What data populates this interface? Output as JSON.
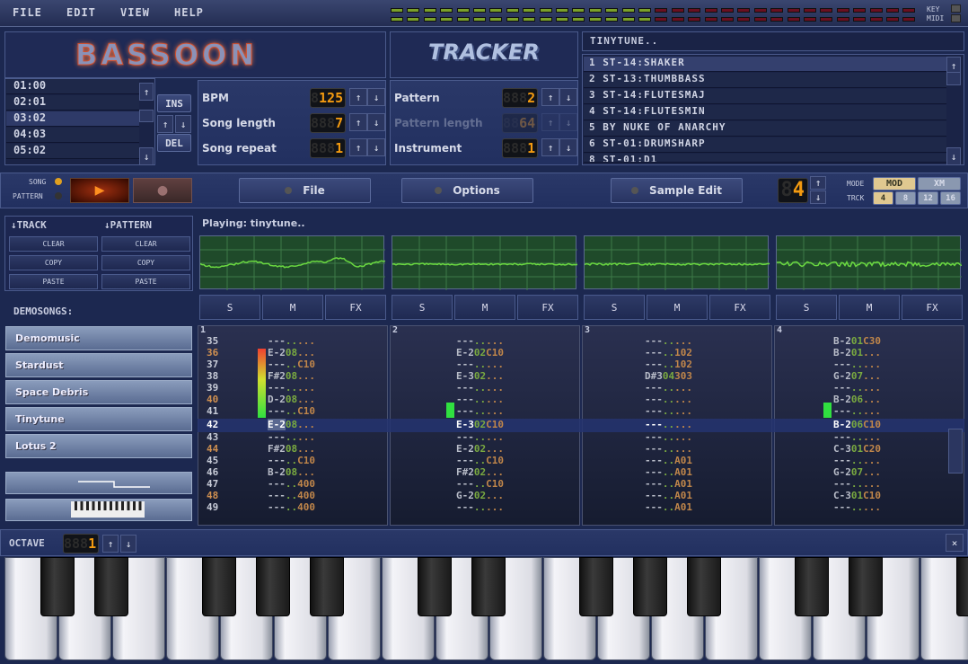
{
  "menu": [
    "FILE",
    "EDIT",
    "VIEW",
    "HELP"
  ],
  "indicators": {
    "key": "KEY",
    "midi": "MIDI"
  },
  "vu": {
    "lit_leds": 16,
    "total_leds": 32,
    "green": "#7aa02a",
    "red": "#6a1020"
  },
  "logo": {
    "title": "BASSOON",
    "subtitle": "TRACKER"
  },
  "song_title": "TINYTUNE..",
  "order_list": [
    "01:00",
    "02:01",
    "03:02",
    "04:03",
    "05:02"
  ],
  "order_selected": 2,
  "order_buttons": {
    "ins": "INS",
    "del": "DEL"
  },
  "song_settings": [
    {
      "label": "BPM",
      "value": "125",
      "ghost": "8",
      "enabled": true
    },
    {
      "label": "Song length",
      "value": "7",
      "ghost": "888",
      "enabled": true
    },
    {
      "label": "Song repeat",
      "value": "1",
      "ghost": "888",
      "enabled": true
    }
  ],
  "pattern_settings": [
    {
      "label": "Pattern",
      "value": "2",
      "ghost": "888",
      "enabled": true
    },
    {
      "label": "Pattern length",
      "value": "64",
      "ghost": "88",
      "enabled": false
    },
    {
      "label": "Instrument",
      "value": "1",
      "ghost": "888",
      "enabled": true
    }
  ],
  "instruments": [
    "1 ST-14:SHAKER",
    "2 ST-13:THUMBBASS",
    "3 ST-14:FLUTESMAJ",
    "4 ST-14:FLUTESMIN",
    "5 BY NUKE OF ANARCHY",
    "6 ST-01:DRUMSHARP",
    "8 ST-01:D1"
  ],
  "transport": {
    "song": "SONG",
    "pattern": "PATTERN",
    "play": "▶",
    "record": "●",
    "mode_selected": "song"
  },
  "nav": {
    "file": "File",
    "options": "Options",
    "sample_edit": "Sample Edit"
  },
  "channels_lcd": "4",
  "channels_ghost": "8",
  "mode": {
    "label": "MODE",
    "options": [
      "MOD",
      "XM"
    ],
    "selected": "MOD"
  },
  "track": {
    "label": "TRCK",
    "options": [
      "4",
      "8",
      "12",
      "16"
    ],
    "selected": "4"
  },
  "edit": {
    "track": "↓TRACK",
    "pattern": "↓PATTERN",
    "clear": "CLEAR",
    "copy": "COPY",
    "paste": "PASTE"
  },
  "demosongs": {
    "label": "DEMOSONGS:",
    "songs": [
      "Demomusic",
      "Stardust",
      "Space Debris",
      "Tinytune",
      "Lotus 2"
    ]
  },
  "status": "Playing: tinytune..",
  "channel_buttons": [
    "S",
    "M",
    "FX"
  ],
  "pattern": {
    "current_row": 42,
    "rows": [
      35,
      36,
      37,
      38,
      39,
      40,
      41,
      42,
      43,
      44,
      45,
      46,
      47,
      48,
      49
    ],
    "channels": [
      {
        "number": "1",
        "vu": 0.55,
        "cells": [
          [
            "---",
            "..",
            "..."
          ],
          [
            "E-2",
            "08",
            "..."
          ],
          [
            "---",
            "..",
            "C10"
          ],
          [
            "F#2",
            "08",
            "..."
          ],
          [
            "---",
            "..",
            "..."
          ],
          [
            "D-2",
            "08",
            "..."
          ],
          [
            "---",
            "..",
            "C10"
          ],
          [
            "E-2",
            "08",
            "..."
          ],
          [
            "---",
            "..",
            "..."
          ],
          [
            "F#2",
            "08",
            "..."
          ],
          [
            "---",
            "..",
            "C10"
          ],
          [
            "B-2",
            "08",
            "..."
          ],
          [
            "---",
            "..",
            "400"
          ],
          [
            "---",
            "..",
            "400"
          ],
          [
            "---",
            "..",
            "400"
          ]
        ]
      },
      {
        "number": "2",
        "vu": 0.12,
        "cells": [
          [
            "---",
            "..",
            "..."
          ],
          [
            "E-2",
            "02",
            "C10"
          ],
          [
            "---",
            "..",
            "..."
          ],
          [
            "E-3",
            "02",
            "..."
          ],
          [
            "---",
            "..",
            "..."
          ],
          [
            "---",
            "..",
            "..."
          ],
          [
            "---",
            "..",
            "..."
          ],
          [
            "E-3",
            "02",
            "C10"
          ],
          [
            "---",
            "..",
            "..."
          ],
          [
            "E-2",
            "02",
            "..."
          ],
          [
            "---",
            "..",
            "C10"
          ],
          [
            "F#2",
            "02",
            "..."
          ],
          [
            "---",
            "..",
            "C10"
          ],
          [
            "G-2",
            "02",
            "..."
          ],
          [
            "---",
            "..",
            "..."
          ]
        ]
      },
      {
        "number": "3",
        "vu": 0,
        "cells": [
          [
            "---",
            "..",
            "..."
          ],
          [
            "---",
            "..",
            "102"
          ],
          [
            "---",
            "..",
            "102"
          ],
          [
            "D#3",
            "04",
            "303"
          ],
          [
            "---",
            "..",
            "..."
          ],
          [
            "---",
            "..",
            "..."
          ],
          [
            "---",
            "..",
            "..."
          ],
          [
            "---",
            "..",
            "..."
          ],
          [
            "---",
            "..",
            "..."
          ],
          [
            "---",
            "..",
            "..."
          ],
          [
            "---",
            "..",
            "A01"
          ],
          [
            "---",
            "..",
            "A01"
          ],
          [
            "---",
            "..",
            "A01"
          ],
          [
            "---",
            "..",
            "A01"
          ],
          [
            "---",
            "..",
            "A01"
          ]
        ]
      },
      {
        "number": "4",
        "vu": 0.12,
        "cells": [
          [
            "B-2",
            "01",
            "C30"
          ],
          [
            "B-2",
            "01",
            "..."
          ],
          [
            "---",
            "..",
            "..."
          ],
          [
            "G-2",
            "07",
            "..."
          ],
          [
            "---",
            "..",
            "..."
          ],
          [
            "B-2",
            "06",
            "..."
          ],
          [
            "---",
            "..",
            "..."
          ],
          [
            "B-2",
            "06",
            "C10"
          ],
          [
            "---",
            "..",
            "..."
          ],
          [
            "C-3",
            "01",
            "C20"
          ],
          [
            "---",
            "..",
            "..."
          ],
          [
            "G-2",
            "07",
            "..."
          ],
          [
            "---",
            "..",
            "..."
          ],
          [
            "C-3",
            "01",
            "C10"
          ],
          [
            "---",
            "..",
            "..."
          ]
        ]
      }
    ]
  },
  "octave": {
    "label": "OCTAVE",
    "value": "1",
    "ghost": "888"
  },
  "close": "×"
}
